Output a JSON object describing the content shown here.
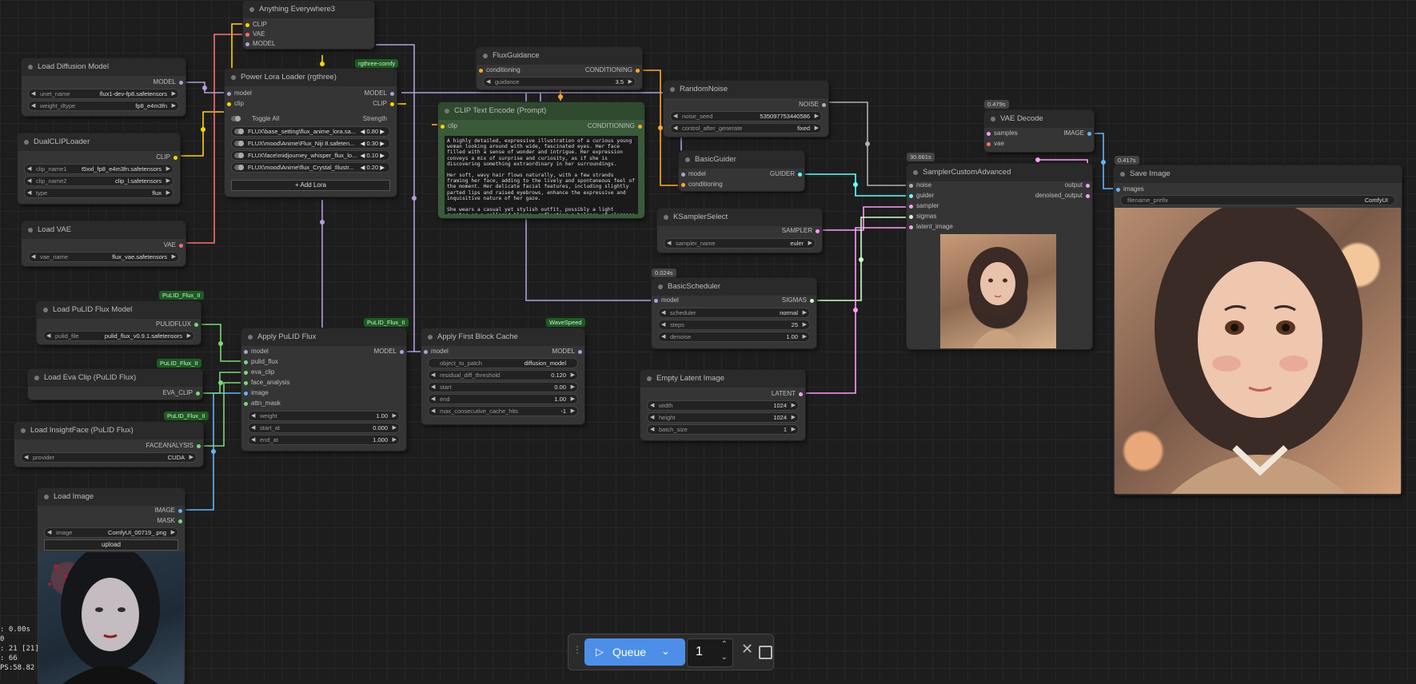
{
  "nodes": {
    "anything_everywhere": {
      "title": "Anything Everywhere3",
      "inputs": [
        "CLIP",
        "VAE",
        "MODEL"
      ]
    },
    "load_diffusion": {
      "title": "Load Diffusion Model",
      "output": "MODEL",
      "w1_label": "unet_name",
      "w1_value": "flux1-dev-fp8.safetensors",
      "w2_label": "weight_dtype",
      "w2_value": "fp8_e4m3fn"
    },
    "dual_clip": {
      "title": "DualCLIPLoader",
      "output": "CLIP",
      "w1_label": "clip_name1",
      "w1_value": "t5xxl_fp8_e4m3fn.safetensors",
      "w2_label": "clip_name2",
      "w2_value": "clip_l.safetensors",
      "w3_label": "type",
      "w3_value": "flux"
    },
    "load_vae": {
      "title": "Load VAE",
      "output": "VAE",
      "w1_label": "vae_name",
      "w1_value": "flux_vae.safetensors"
    },
    "power_lora": {
      "title": "Power Lora Loader (rgthree)",
      "badge": "rgthree-comfy",
      "in_model": "model",
      "in_clip": "clip",
      "out_model": "MODEL",
      "out_clip": "CLIP",
      "toggle_all": "Toggle All",
      "strength": "Strength",
      "loras": [
        {
          "name": "FLUX\\base_setting\\flux_anime_lora.sa...",
          "value": "0.80"
        },
        {
          "name": "FLUX\\mood\\Anime\\Flux_Niji 8.safeten...",
          "value": "0.30"
        },
        {
          "name": "FLUX\\face\\midjourney_whisper_flux_lo...",
          "value": "0.10"
        },
        {
          "name": "FLUX\\mood\\Anime\\flux_Crystal_Illustr...",
          "value": "0.20"
        }
      ],
      "add_lora": "+ Add Lora"
    },
    "flux_guidance": {
      "title": "FluxGuidance",
      "in": "conditioning",
      "out": "CONDITIONING",
      "w1_label": "guidance",
      "w1_value": "3.5"
    },
    "clip_text": {
      "title": "CLIP Text Encode (Prompt)",
      "in": "clip",
      "out": "CONDITIONING",
      "p1": "A highly detailed, expressive illustration of a curious young woman looking around with wide, fascinated eyes. Her face filled with a sense of wonder and intrigue. Her expression conveys a mix of surprise and curiosity, as if she is discovering something extraordinary in her surroundings.",
      "p2": "Her soft, wavy hair flows naturally, with a few strands framing her face, adding to the lively and spontaneous feel of the moment. Her delicate facial features, including slightly parted lips and raised eyebrows, enhance the expressive and inquisitive nature of her gaze.",
      "p3": "She wears a casual yet stylish outfit, possibly a light sweater or a collared blouse, reflecting a balance of elegance and everyday charm. The lighting is soft and warm, casting gentle highlights on her smooth skin"
    },
    "random_noise": {
      "title": "RandomNoise",
      "out": "NOISE",
      "w1_label": "noise_seed",
      "w1_value": "535097753440586",
      "w2_label": "control_after_generate",
      "w2_value": "fixed"
    },
    "basic_guider": {
      "title": "BasicGuider",
      "in1": "model",
      "in2": "conditioning",
      "out": "GUIDER"
    },
    "ksampler_select": {
      "title": "KSamplerSelect",
      "out": "SAMPLER",
      "w1_label": "sampler_name",
      "w1_value": "euler"
    },
    "basic_scheduler": {
      "title": "BasicScheduler",
      "timing": "0.024s",
      "in": "model",
      "out": "SIGMAS",
      "w1_label": "scheduler",
      "w1_value": "normal",
      "w2_label": "steps",
      "w2_value": "25",
      "w3_label": "denoise",
      "w3_value": "1.00"
    },
    "empty_latent": {
      "title": "Empty Latent Image",
      "out": "LATENT",
      "w1_label": "width",
      "w1_value": "1024",
      "w2_label": "height",
      "w2_value": "1024",
      "w3_label": "batch_size",
      "w3_value": "1"
    },
    "sampler_custom": {
      "title": "SamplerCustomAdvanced",
      "timing": "30.661s",
      "inputs": [
        "noise",
        "guider",
        "sampler",
        "sigmas",
        "latent_image"
      ],
      "out1": "output",
      "out2": "denoised_output"
    },
    "vae_decode": {
      "title": "VAE Decode",
      "timing": "0.479s",
      "in1": "samples",
      "in2": "vae",
      "out": "IMAGE"
    },
    "save_image": {
      "title": "Save Image",
      "timing": "0.417s",
      "in": "images",
      "w1_label": "filename_prefix",
      "w1_value": "ComfyUI"
    },
    "load_pulid": {
      "title": "Load PuLID Flux Model",
      "badge": "PuLID_Flux_II",
      "out": "PULIDFLUX",
      "w1_label": "pulid_file",
      "w1_value": "pulid_flux_v0.9.1.safetensors"
    },
    "load_eva": {
      "title": "Load Eva Clip (PuLID Flux)",
      "badge": "PuLID_Flux_II",
      "out": "EVA_CLIP"
    },
    "load_insight": {
      "title": "Load InsightFace (PuLID Flux)",
      "badge": "PuLID_Flux_II",
      "out": "FACEANALYSIS",
      "w1_label": "provider",
      "w1_value": "CUDA"
    },
    "apply_pulid": {
      "title": "Apply PuLID Flux",
      "badge": "PuLID_Flux_II",
      "inputs": [
        "model",
        "pulid_flux",
        "eva_clip",
        "face_analysis",
        "image",
        "attn_mask"
      ],
      "out": "MODEL",
      "w1_label": "weight",
      "w1_value": "1.00",
      "w2_label": "start_at",
      "w2_value": "0.000",
      "w3_label": "end_at",
      "w3_value": "1.000"
    },
    "first_block_cache": {
      "title": "Apply First Block Cache",
      "badge": "WaveSpeed",
      "in": "model",
      "out": "MODEL",
      "w1_label": "object_to_patch",
      "w1_value": "diffusion_model",
      "w2_label": "residual_diff_threshold",
      "w2_value": "0.120",
      "w3_label": "start",
      "w3_value": "0.00",
      "w4_label": "end",
      "w4_value": "1.00",
      "w5_label": "max_consecutive_cache_hits",
      "w5_value": "-1"
    },
    "load_image": {
      "title": "Load Image",
      "out1": "IMAGE",
      "out2": "MASK",
      "w1_label": "image",
      "w1_value": "ComfyUI_00719_.png",
      "upload": "upload"
    }
  },
  "stats": {
    "l1": ": 0.00s",
    "l2": "0",
    "l3": ": 21 [21]",
    "l4": ": 66",
    "l5": "PS:58.82"
  },
  "queue": {
    "label": "Queue",
    "count": "1"
  },
  "colors": {
    "model": "#b39ddb",
    "clip": "#ffd500",
    "vae": "#ff6e6e",
    "conditioning": "#ffa931",
    "image": "#64b5f6",
    "latent": "#ff9cf9",
    "guider": "#66ffff",
    "sigmas": "#cdffcd",
    "noise": "#b0b0b0",
    "pulid": "#7ad97a",
    "accent": "#4d8fe8"
  }
}
